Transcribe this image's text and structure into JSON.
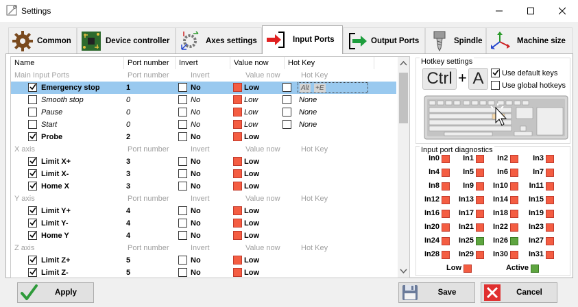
{
  "window": {
    "title": "Settings"
  },
  "tabs": [
    {
      "label": "Common"
    },
    {
      "label": "Device controller"
    },
    {
      "label": "Axes settings"
    },
    {
      "label": "Input Ports"
    },
    {
      "label": "Output Ports"
    },
    {
      "label": "Spindle"
    },
    {
      "label": "Machine size"
    }
  ],
  "table": {
    "headers": {
      "name": "Name",
      "port": "Port number",
      "invert": "Invert",
      "value": "Value now",
      "hotkey": "Hot Key"
    },
    "rows": [
      {
        "group": true,
        "name": "Main Input Ports",
        "port": "Port number",
        "invert": "Invert",
        "value": "Value now",
        "hotkey": "Hot Key"
      },
      {
        "name": "Emergency stop",
        "port": "1",
        "invert": "No",
        "value": "Low",
        "checked": true,
        "enabled": true,
        "hk_cb": true,
        "hk_mod": "Alt",
        "hk_key": "+E",
        "selected": true
      },
      {
        "name": "Smooth stop",
        "port": "0",
        "invert": "No",
        "value": "Low",
        "checked": false,
        "enabled": false,
        "hk_cb": true,
        "hk_text": "None"
      },
      {
        "name": "Pause",
        "port": "0",
        "invert": "No",
        "value": "Low",
        "checked": false,
        "enabled": false,
        "hk_cb": true,
        "hk_text": "None"
      },
      {
        "name": "Start",
        "port": "0",
        "invert": "No",
        "value": "Low",
        "checked": false,
        "enabled": false,
        "hk_cb": true,
        "hk_text": "None"
      },
      {
        "name": "Probe",
        "port": "2",
        "invert": "No",
        "value": "Low",
        "checked": true,
        "enabled": true
      },
      {
        "group": true,
        "name": "X axis",
        "port": "Port number",
        "invert": "Invert",
        "value": "Value now",
        "hotkey": "Hot Key"
      },
      {
        "name": "Limit X+",
        "port": "3",
        "invert": "No",
        "value": "Low",
        "checked": true,
        "enabled": true
      },
      {
        "name": "Limit X-",
        "port": "3",
        "invert": "No",
        "value": "Low",
        "checked": true,
        "enabled": true
      },
      {
        "name": "Home X",
        "port": "3",
        "invert": "No",
        "value": "Low",
        "checked": true,
        "enabled": true
      },
      {
        "group": true,
        "name": "Y axis",
        "port": "Port number",
        "invert": "Invert",
        "value": "Value now",
        "hotkey": "Hot Key"
      },
      {
        "name": "Limit Y+",
        "port": "4",
        "invert": "No",
        "value": "Low",
        "checked": true,
        "enabled": true
      },
      {
        "name": "Limit Y-",
        "port": "4",
        "invert": "No",
        "value": "Low",
        "checked": true,
        "enabled": true
      },
      {
        "name": "Home Y",
        "port": "4",
        "invert": "No",
        "value": "Low",
        "checked": true,
        "enabled": true
      },
      {
        "group": true,
        "name": "Z axis",
        "port": "Port number",
        "invert": "Invert",
        "value": "Value now",
        "hotkey": "Hot Key"
      },
      {
        "name": "Limit Z+",
        "port": "5",
        "invert": "No",
        "value": "Low",
        "checked": true,
        "enabled": true
      },
      {
        "name": "Limit Z-",
        "port": "5",
        "invert": "No",
        "value": "Low",
        "checked": true,
        "enabled": true
      }
    ]
  },
  "hotkeys": {
    "title": "Hotkey settings",
    "key1": "Ctrl",
    "plus": "+",
    "key2": "A",
    "use_default": {
      "label": "Use default keys",
      "checked": true
    },
    "use_global": {
      "label": "Use global hotkeys",
      "checked": false
    }
  },
  "diagnostics": {
    "title": "Input port diagnostics",
    "ports": [
      {
        "label": "In0",
        "active": false
      },
      {
        "label": "In1",
        "active": false
      },
      {
        "label": "In2",
        "active": false
      },
      {
        "label": "In3",
        "active": false
      },
      {
        "label": "In4",
        "active": false
      },
      {
        "label": "In5",
        "active": false
      },
      {
        "label": "In6",
        "active": false
      },
      {
        "label": "In7",
        "active": false
      },
      {
        "label": "In8",
        "active": false
      },
      {
        "label": "In9",
        "active": false
      },
      {
        "label": "In10",
        "active": false
      },
      {
        "label": "In11",
        "active": false
      },
      {
        "label": "In12",
        "active": false
      },
      {
        "label": "In13",
        "active": false
      },
      {
        "label": "In14",
        "active": false
      },
      {
        "label": "In15",
        "active": false
      },
      {
        "label": "In16",
        "active": false
      },
      {
        "label": "In17",
        "active": false
      },
      {
        "label": "In18",
        "active": false
      },
      {
        "label": "In19",
        "active": false
      },
      {
        "label": "In20",
        "active": false
      },
      {
        "label": "In21",
        "active": false
      },
      {
        "label": "In22",
        "active": false
      },
      {
        "label": "In23",
        "active": false
      },
      {
        "label": "In24",
        "active": false
      },
      {
        "label": "In25",
        "active": true
      },
      {
        "label": "In26",
        "active": true
      },
      {
        "label": "In27",
        "active": false
      },
      {
        "label": "In28",
        "active": false
      },
      {
        "label": "In29",
        "active": false
      },
      {
        "label": "In30",
        "active": false
      },
      {
        "label": "In31",
        "active": false
      }
    ],
    "legend_low": "Low",
    "legend_active": "Active"
  },
  "buttons": {
    "apply": "Apply",
    "save": "Save",
    "cancel": "Cancel"
  },
  "colors": {
    "low": "#f45d42",
    "active": "#5ea540",
    "selection": "#99c9ef"
  }
}
